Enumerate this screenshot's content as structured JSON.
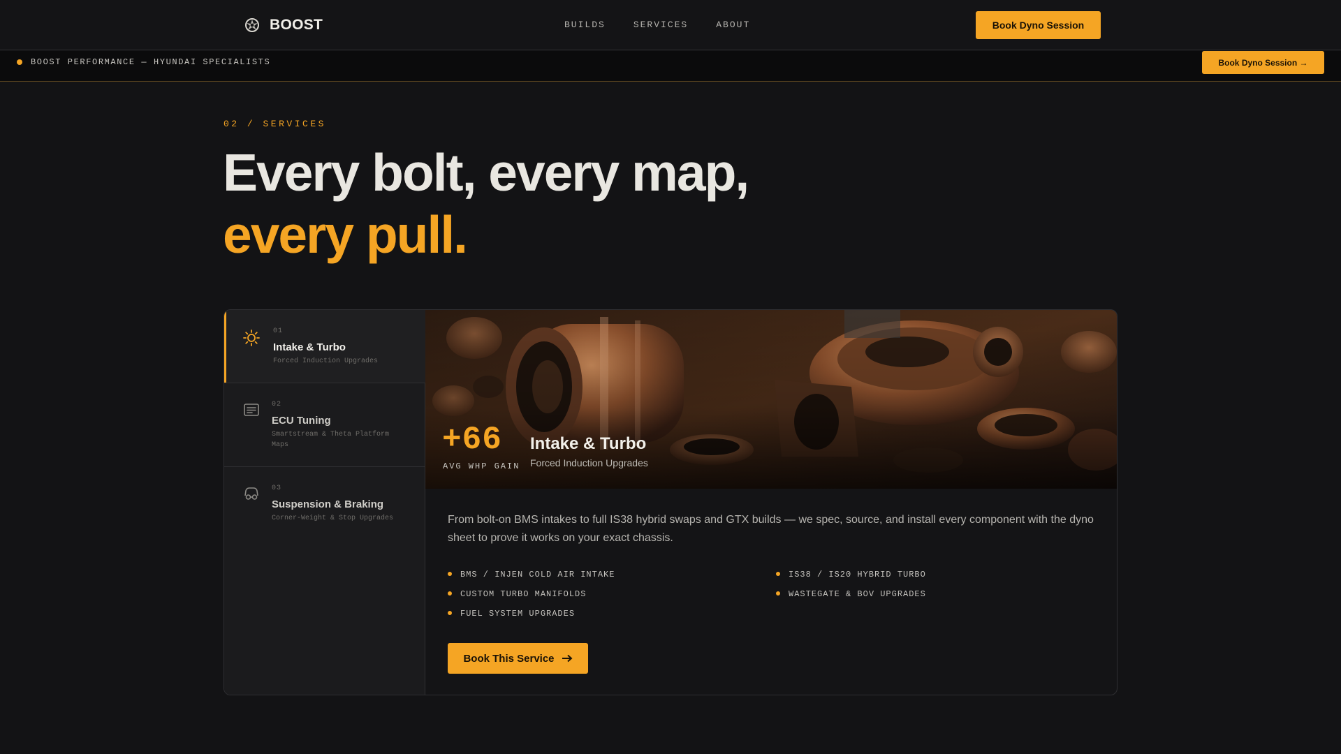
{
  "brand": {
    "name": "BOOST",
    "logo_icon": "turbo-logo-icon"
  },
  "nav": {
    "links": [
      "BUILDS",
      "SERVICES",
      "ABOUT"
    ],
    "cta": "Book Dyno Session"
  },
  "announcement": {
    "text": "BOOST PERFORMANCE — HYUNDAI SPECIALISTS",
    "cta": "Book Dyno Session →"
  },
  "hero": {
    "eyebrow": "02 / SERVICES",
    "headline_line1": "Every bolt, every map,",
    "headline_line2": "every pull."
  },
  "services": [
    {
      "num": "01",
      "title": "Intake & Turbo",
      "subtitle": "Forced Induction Upgrades",
      "icon": "turbo-icon",
      "active": true
    },
    {
      "num": "02",
      "title": "ECU Tuning",
      "subtitle": "Smartstream & Theta Platform Maps",
      "icon": "ecu-icon",
      "active": false
    },
    {
      "num": "03",
      "title": "Suspension & Braking",
      "subtitle": "Corner-Weight & Stop Upgrades",
      "icon": "car-icon",
      "active": false
    }
  ],
  "detail": {
    "stat_value": "+66",
    "stat_label": "AVG WHP GAIN",
    "title": "Intake & Turbo",
    "subtitle": "Forced Induction Upgrades",
    "description": "From bolt-on BMS intakes to full IS38 hybrid swaps and GTX builds — we spec, source, and install every component with the dyno sheet to prove it works on your exact chassis.",
    "features": [
      "BMS / INJEN COLD AIR INTAKE",
      "IS38 / IS20 HYBRID TURBO",
      "CUSTOM TURBO MANIFOLDS",
      "WASTEGATE & BOV UPGRADES",
      "FUEL SYSTEM UPGRADES"
    ],
    "cta": "Book This Service"
  },
  "colors": {
    "accent": "#f5a524",
    "background": "#131315",
    "panel": "#1b1b1d"
  }
}
